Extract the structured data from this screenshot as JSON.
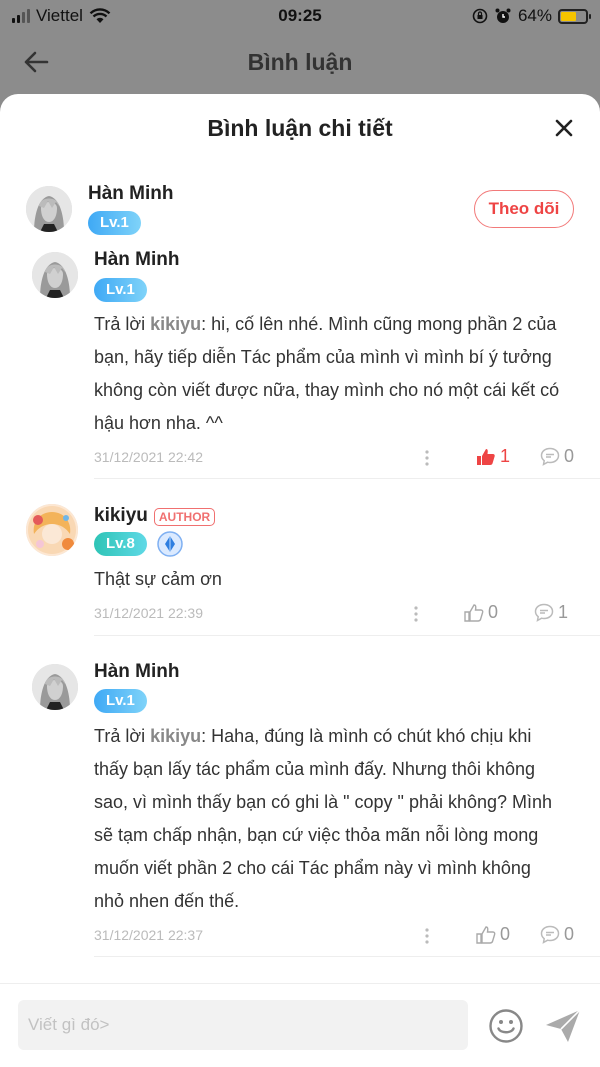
{
  "status_bar": {
    "carrier": "Viettel",
    "time": "09:25",
    "battery": "64%"
  },
  "header": {
    "title": "Bình luận"
  },
  "sheet": {
    "title": "Bình luận chi tiết"
  },
  "root_comment": {
    "author": "Hàn Minh",
    "level": "Lv.1",
    "follow_label": "Theo dõi"
  },
  "replies": [
    {
      "author": "Hàn Minh",
      "level": "Lv.1",
      "reply_prefix": "Trả lời ",
      "reply_to": "kikiyu",
      "text": ": hi, cố lên nhé. Mình cũng mong phần 2 của bạn, hãy tiếp diễn Tác phẩm của mình  vì mình bí ý tưởng không còn viết được nữa, thay mình cho nó một cái kết có hậu hơn nha. ^^",
      "timestamp": "31/12/2021 22:42",
      "likes": "1",
      "comments": "0"
    },
    {
      "author": "kikiyu",
      "author_tag": "AUTHOR",
      "level": "Lv.8",
      "text": "Thật sự cảm ơn",
      "timestamp": "31/12/2021 22:39",
      "likes": "0",
      "comments": "1"
    },
    {
      "author": "Hàn Minh",
      "level": "Lv.1",
      "reply_prefix": "Trả lời ",
      "reply_to": "kikiyu",
      "text": ": Haha, đúng là mình có chút khó chịu khi thấy bạn lấy tác phẩm của mình đấy. Nhưng thôi không sao, vì mình thấy bạn có ghi là \" copy \" phải không? Mình sẽ tạm chấp nhận, bạn cứ việc thỏa mãn nỗi lòng mong muốn viết phần 2 cho cái Tác phẩm này vì mình không nhỏ nhen đến thế.",
      "timestamp": "31/12/2021 22:37",
      "likes": "0",
      "comments": "0"
    }
  ],
  "input": {
    "placeholder": "Viết gì đó>"
  },
  "colors": {
    "accent_red": "#e44444",
    "level_blue": "#3fa9f5",
    "level_teal": "#2ec4b6",
    "battery": "#f5c400"
  }
}
